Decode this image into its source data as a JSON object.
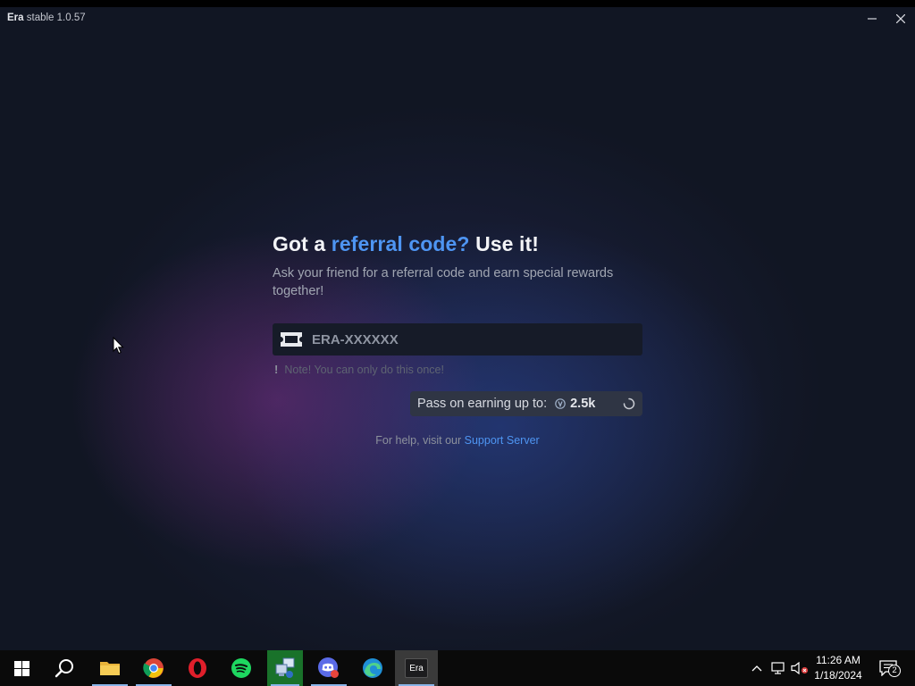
{
  "window": {
    "app_name": "Era",
    "app_version": "stable 1.0.57"
  },
  "referral": {
    "title_part1": "Got a ",
    "title_accent": "referral code?",
    "title_part2": " Use it!",
    "subtitle": "Ask your friend for a referral code and earn special rewards together!",
    "input_placeholder": "ERA-XXXXXX",
    "note_mark": "!",
    "note": "Note! You can only do this once!",
    "reward_label": "Pass on earning up to:",
    "reward_value": "2.5k",
    "help_text": "For help, visit our ",
    "help_link": "Support Server"
  },
  "taskbar": {
    "apps": [
      {
        "name": "start",
        "icon": "windows-logo-icon"
      },
      {
        "name": "search",
        "icon": "search-icon"
      },
      {
        "name": "file-explorer",
        "icon": "folder-icon"
      },
      {
        "name": "chrome",
        "icon": "chrome-icon"
      },
      {
        "name": "opera",
        "icon": "opera-icon"
      },
      {
        "name": "spotify",
        "icon": "spotify-icon"
      },
      {
        "name": "network-tool",
        "icon": "network-tool-icon"
      },
      {
        "name": "discord",
        "icon": "discord-icon"
      },
      {
        "name": "edge",
        "icon": "edge-icon"
      },
      {
        "name": "era",
        "icon": "era-icon",
        "label": "Era"
      }
    ],
    "clock_time": "11:26 AM",
    "clock_date": "1/18/2024",
    "notification_count": "2"
  },
  "colors": {
    "accent": "#4e95f2",
    "background": "#111623",
    "taskbar": "#0a0a0a",
    "active_app": "#19722a"
  }
}
